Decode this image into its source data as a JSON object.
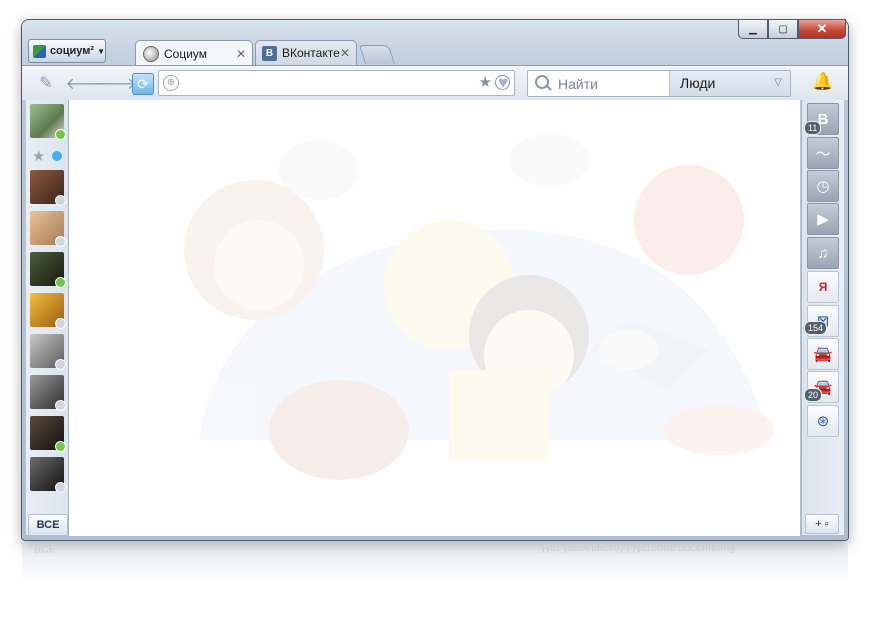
{
  "app_menu": {
    "label": "социум²"
  },
  "tabs": [
    {
      "label": "Социум"
    },
    {
      "label": "ВКонтакте",
      "icon_letter": "В"
    }
  ],
  "search": {
    "placeholder": "Найти",
    "scope": "Люди"
  },
  "sidebar_left": {
    "all_button": "ВСЕ",
    "friends": [
      {
        "online": true,
        "color": "#6a8a4a"
      },
      {
        "online": false,
        "color": "#5a3a2a"
      },
      {
        "online": false,
        "color": "#c99a6a"
      },
      {
        "online": true,
        "color": "#2c3a24"
      },
      {
        "online": false,
        "color": "#c48a1a"
      },
      {
        "online": false,
        "color": "#8c8c8c"
      },
      {
        "online": false,
        "color": "#4a4a4a"
      },
      {
        "online": true,
        "color": "#2a2420"
      },
      {
        "online": false,
        "color": "#3a3a3a"
      }
    ]
  },
  "sidebar_right": {
    "badges": {
      "vk": "11",
      "widget": "154",
      "traffic": "20"
    },
    "add_button": "+"
  },
  "reflection": {
    "left": "ВСЕ",
    "right": "Чат (переписка) | История посещений"
  }
}
